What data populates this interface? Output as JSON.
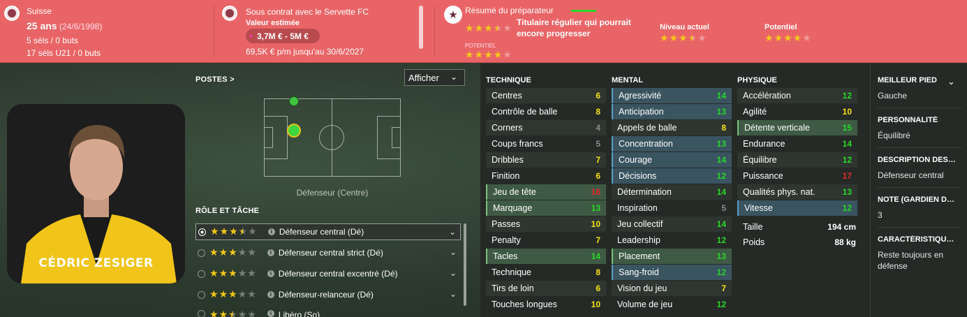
{
  "header": {
    "nation": "Suisse",
    "age": "25 ans",
    "dob": "(24/6/1998)",
    "caps": "5 séls / 0 buts",
    "caps_u21": "17 séls U21 / 0 buts",
    "contract": "Sous contrat avec le Servette FC",
    "value_label": "Valeur estimée",
    "value": "3,7M € - 5M €",
    "wage": "69,5K € p/m jusqu'au 30/6/2027",
    "report_title": "Résumé du préparateur",
    "report_text": "Titulaire régulier qui pourrait encore progresser",
    "potential_label": "POTENTIEL",
    "current_level_label": "Niveau actuel",
    "potential_col_label": "Potentiel",
    "report_stars": 3.5,
    "report_potential_stars": 4,
    "current_level_stars": 3.5,
    "potential_stars": 4
  },
  "left": {
    "positions_label": "POSTES >",
    "show_label": "Afficher",
    "position_name": "Défenseur (Centre)",
    "roles_label": "RÔLE ET TÂCHE",
    "photo_name": "CÉDRIC ZESIGER",
    "roles": [
      {
        "label": "Défenseur central (Dé)",
        "stars": 3.5
      },
      {
        "label": "Défenseur central strict (Dé)",
        "stars": 3
      },
      {
        "label": "Défenseur central excentré (Dé)",
        "stars": 3
      },
      {
        "label": "Défenseur-relanceur (Dé)",
        "stars": 3
      },
      {
        "label": "Libéro (So)",
        "stars": 2.5
      }
    ]
  },
  "attributes": {
    "technique_label": "TECHNIQUE",
    "mental_label": "MENTAL",
    "physique_label": "PHYSIQUE",
    "technique": [
      {
        "name": "Centres",
        "value": "6"
      },
      {
        "name": "Contrôle de balle",
        "value": "8"
      },
      {
        "name": "Corners",
        "value": "4"
      },
      {
        "name": "Coups francs",
        "value": "5"
      },
      {
        "name": "Dribbles",
        "value": "7"
      },
      {
        "name": "Finition",
        "value": "6"
      },
      {
        "name": "Jeu de tête",
        "value": "16"
      },
      {
        "name": "Marquage",
        "value": "13"
      },
      {
        "name": "Passes",
        "value": "10"
      },
      {
        "name": "Penalty",
        "value": "7"
      },
      {
        "name": "Tacles",
        "value": "14"
      },
      {
        "name": "Technique",
        "value": "8"
      },
      {
        "name": "Tirs de loin",
        "value": "6"
      },
      {
        "name": "Touches longues",
        "value": "10"
      }
    ],
    "mental": [
      {
        "name": "Agressivité",
        "value": "14"
      },
      {
        "name": "Anticipation",
        "value": "13"
      },
      {
        "name": "Appels de balle",
        "value": "8"
      },
      {
        "name": "Concentration",
        "value": "13"
      },
      {
        "name": "Courage",
        "value": "14"
      },
      {
        "name": "Décisions",
        "value": "12"
      },
      {
        "name": "Détermination",
        "value": "14"
      },
      {
        "name": "Inspiration",
        "value": "5"
      },
      {
        "name": "Jeu collectif",
        "value": "14"
      },
      {
        "name": "Leadership",
        "value": "12"
      },
      {
        "name": "Placement",
        "value": "13"
      },
      {
        "name": "Sang-froid",
        "value": "12"
      },
      {
        "name": "Vision du jeu",
        "value": "7"
      },
      {
        "name": "Volume de jeu",
        "value": "12"
      }
    ],
    "physique": [
      {
        "name": "Accélération",
        "value": "12"
      },
      {
        "name": "Agilité",
        "value": "10"
      },
      {
        "name": "Détente verticale",
        "value": "15"
      },
      {
        "name": "Endurance",
        "value": "14"
      },
      {
        "name": "Équilibre",
        "value": "12"
      },
      {
        "name": "Puissance",
        "value": "17"
      },
      {
        "name": "Qualités phys. nat.",
        "value": "13"
      },
      {
        "name": "Vitesse",
        "value": "12"
      }
    ],
    "height_label": "Taille",
    "height": "194 cm",
    "weight_label": "Poids",
    "weight": "88 kg"
  },
  "side": {
    "foot_label": "MEILLEUR PIED",
    "foot": "Gauche",
    "personality_label": "PERSONNALITÉ",
    "personality": "Équilibré",
    "media_label": "DESCRIPTION DES M...",
    "media": "Défenseur central",
    "gk_label": "NOTE (GARDIEN DE...",
    "gk": "3",
    "traits_label": "CARACTÉRISTIQUES...",
    "traits": "Reste toujours en défense"
  },
  "colors": {
    "header": "#e96466",
    "good": "#27d927",
    "mid": "#f5e316",
    "low": "#8a8a8a",
    "high": "#e32b2b"
  }
}
